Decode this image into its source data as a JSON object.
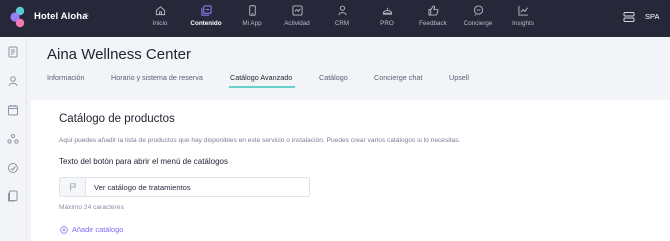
{
  "brand": {
    "name": "Hotel Aloha",
    "menu_glyph": "≡",
    "right_label": "SPA"
  },
  "nav": [
    {
      "label": "Inicio",
      "icon": "home-icon"
    },
    {
      "label": "Contenido",
      "icon": "content-icon",
      "active": true
    },
    {
      "label": "Mi App",
      "icon": "phone-icon"
    },
    {
      "label": "Actividad",
      "icon": "activity-icon"
    },
    {
      "label": "CRM",
      "icon": "crm-icon"
    },
    {
      "label": "PRO",
      "icon": "pro-icon"
    },
    {
      "label": "Feedback",
      "icon": "thumbs-up-icon"
    },
    {
      "label": "Concierge",
      "icon": "chat-icon"
    },
    {
      "label": "Insights",
      "icon": "chart-icon"
    }
  ],
  "page": {
    "title": "Aina Wellness Center"
  },
  "tabs": [
    {
      "label": "Información"
    },
    {
      "label": "Horario y sistema de reserva"
    },
    {
      "label": "Catálogo Avanzado",
      "active": true
    },
    {
      "label": "Catálogo"
    },
    {
      "label": "Concierge chat"
    },
    {
      "label": "Upsell"
    }
  ],
  "section": {
    "title": "Catálogo de productos",
    "description": "Aquí puedes añadir la lista de productos que hay disponibles en este servicio o instalación. Puedes crear varios catálogos si lo necesitas.",
    "field_label": "Texto del botón para abrir el menú de catálogos",
    "input_value": "Ver catálogo de tratamientos",
    "hint": "Máximo 24 caracteres",
    "add_label": "Añadir catálogo"
  },
  "colors": {
    "topbar": "#26283a",
    "accent": "#7b6cf6",
    "tab_underline": "#6ad1c8"
  }
}
